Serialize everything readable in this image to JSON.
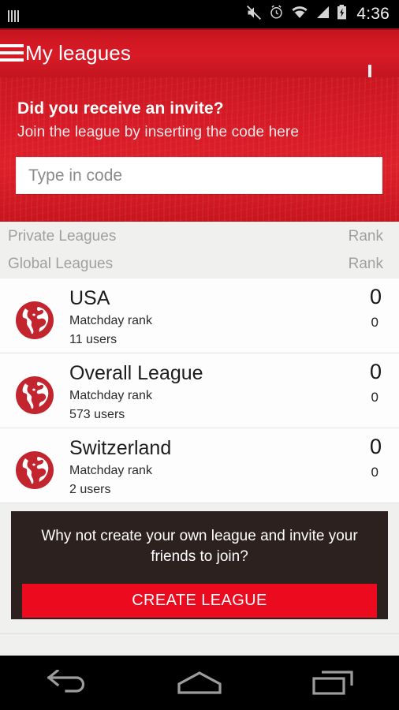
{
  "status_bar": {
    "left_icon": "signal-bars-icon",
    "icons": [
      "mute-icon",
      "alarm-clock-icon",
      "wifi-icon",
      "cellular-signal-icon",
      "battery-charging-icon"
    ],
    "time": "4:36"
  },
  "app_bar": {
    "menu_icon": "hamburger-menu-icon",
    "title": "My leagues",
    "add_icon": "plus-icon"
  },
  "invite": {
    "heading": "Did you receive an invite?",
    "subheading": "Join the league by inserting the code here",
    "input_value": "",
    "input_placeholder": "Type in code"
  },
  "sections": [
    {
      "label": "Private Leagues",
      "rank_label": "Rank"
    },
    {
      "label": "Global Leagues",
      "rank_label": "Rank"
    }
  ],
  "leagues": [
    {
      "icon": "globe-icon",
      "name": "USA",
      "subtitle": "Matchday rank",
      "users": "11 users",
      "rank": "0",
      "matchday_rank": "0"
    },
    {
      "icon": "globe-icon",
      "name": "Overall League",
      "subtitle": "Matchday rank",
      "users": "573 users",
      "rank": "0",
      "matchday_rank": "0"
    },
    {
      "icon": "globe-icon",
      "name": "Switzerland",
      "subtitle": "Matchday rank",
      "users": "2 users",
      "rank": "0",
      "matchday_rank": "0"
    }
  ],
  "promo": {
    "text": "Why not create your own league and invite your friends to join?",
    "button_label": "CREATE LEAGUE"
  },
  "nav_bar": {
    "back": "back-arrow-icon",
    "home": "home-icon",
    "recents": "recent-apps-icon"
  },
  "colors": {
    "brand_red": "#d81b26",
    "button_red": "#eb0a1e",
    "promo_dark": "#2d211f",
    "page_bg": "#f0f0ee",
    "section_text": "#a0a0a0"
  }
}
